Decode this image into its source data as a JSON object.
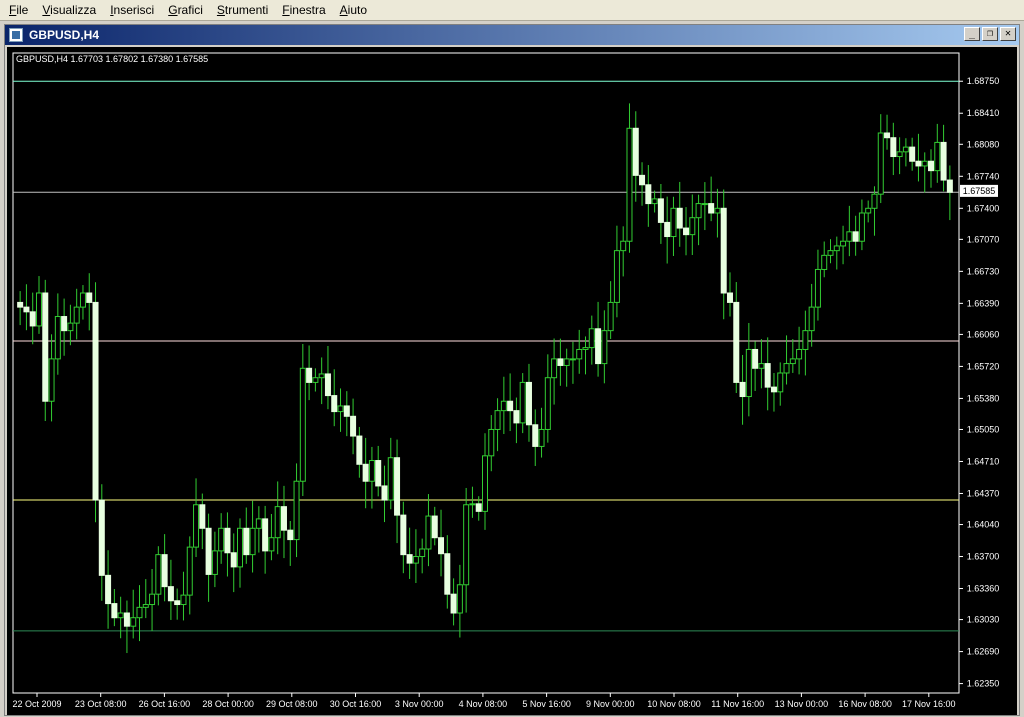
{
  "menu": [
    {
      "label": "File",
      "u": "F",
      "rest": "ile"
    },
    {
      "label": "Visualizza",
      "u": "V",
      "rest": "isualizza"
    },
    {
      "label": "Inserisci",
      "u": "I",
      "rest": "nserisci"
    },
    {
      "label": "Grafici",
      "u": "G",
      "rest": "rafici"
    },
    {
      "label": "Strumenti",
      "u": "S",
      "rest": "trumenti"
    },
    {
      "label": "Finestra",
      "u": "F",
      "rest": "inestra"
    },
    {
      "label": "Aiuto",
      "u": "A",
      "rest": "iuto"
    }
  ],
  "window": {
    "title": "GBPUSD,H4",
    "buttons": {
      "minimize": "_",
      "restore": "❐",
      "close": "✕"
    }
  },
  "colors": {
    "background": "#000000",
    "axis": "#ffffff",
    "candle_bull_fill": "#e8ffe0",
    "candle_wick": "#32cd32",
    "level_top": "#7fffd4",
    "level_mid": "#c0c0c0",
    "level_pink": "#ffdede",
    "level_yellow": "#ffff80",
    "level_green": "#2e8b57"
  },
  "chart_data": {
    "type": "candlestick",
    "title": "GBPUSD,H4  1.67703 1.67802 1.67380 1.67585",
    "symbol": "GBPUSD,H4",
    "ohlc_readout": "1.67703 1.67802 1.67380 1.67585",
    "ylim": [
      1.6225,
      1.6905
    ],
    "y_ticks": [
      "1.68750",
      "1.68410",
      "1.68080",
      "1.67740",
      "1.67400",
      "1.67070",
      "1.66730",
      "1.66390",
      "1.66060",
      "1.65720",
      "1.65380",
      "1.65050",
      "1.64710",
      "1.64370",
      "1.64040",
      "1.63700",
      "1.63360",
      "1.63030",
      "1.62690",
      "1.62350"
    ],
    "current_price": "1.67585",
    "x_ticks": [
      "22 Oct 2009",
      "23 Oct 08:00",
      "26 Oct 16:00",
      "28 Oct 00:00",
      "29 Oct 08:00",
      "30 Oct 16:00",
      "3 Nov 00:00",
      "4 Nov 08:00",
      "5 Nov 16:00",
      "9 Nov 00:00",
      "10 Nov 08:00",
      "11 Nov 16:00",
      "13 Nov 00:00",
      "16 Nov 08:00",
      "17 Nov 16:00"
    ],
    "levels": [
      1.6875,
      1.6757,
      1.6599,
      1.643,
      1.6291
    ],
    "close_series": [
      1.6635,
      1.663,
      1.6615,
      1.665,
      1.6535,
      1.658,
      1.6625,
      1.661,
      1.6618,
      1.6635,
      1.665,
      1.664,
      1.643,
      1.635,
      1.632,
      1.6305,
      1.631,
      1.6296,
      1.6305,
      1.6316,
      1.6319,
      1.633,
      1.6372,
      1.6338,
      1.6323,
      1.6319,
      1.6329,
      1.638,
      1.6425,
      1.64,
      1.6351,
      1.6376,
      1.64,
      1.6374,
      1.6359,
      1.64,
      1.6372,
      1.64,
      1.641,
      1.6376,
      1.639,
      1.6423,
      1.6398,
      1.6388,
      1.645,
      1.657,
      1.6555,
      1.656,
      1.6564,
      1.6541,
      1.6524,
      1.653,
      1.6519,
      1.6498,
      1.6468,
      1.645,
      1.6472,
      1.6445,
      1.643,
      1.6475,
      1.6414,
      1.6372,
      1.6363,
      1.637,
      1.6378,
      1.6413,
      1.639,
      1.6373,
      1.633,
      1.631,
      1.634,
      1.6425,
      1.6426,
      1.6418,
      1.6477,
      1.6505,
      1.6525,
      1.6535,
      1.6525,
      1.6512,
      1.6555,
      1.651,
      1.6487,
      1.6505,
      1.656,
      1.658,
      1.6573,
      1.658,
      1.658,
      1.659,
      1.6592,
      1.6612,
      1.6575,
      1.661,
      1.664,
      1.6695,
      1.6705,
      1.6825,
      1.6775,
      1.6765,
      1.6745,
      1.675,
      1.6725,
      1.671,
      1.674,
      1.6719,
      1.6712,
      1.673,
      1.6745,
      1.6745,
      1.6735,
      1.674,
      1.665,
      1.664,
      1.6555,
      1.654,
      1.659,
      1.657,
      1.6575,
      1.655,
      1.6545,
      1.6565,
      1.6575,
      1.658,
      1.659,
      1.661,
      1.6635,
      1.6675,
      1.669,
      1.6695,
      1.67,
      1.6705,
      1.6715,
      1.6705,
      1.6735,
      1.674,
      1.6755,
      1.682,
      1.6815,
      1.6795,
      1.68,
      1.6805,
      1.679,
      1.6785,
      1.679,
      1.678,
      1.681,
      1.677,
      1.6757
    ]
  }
}
